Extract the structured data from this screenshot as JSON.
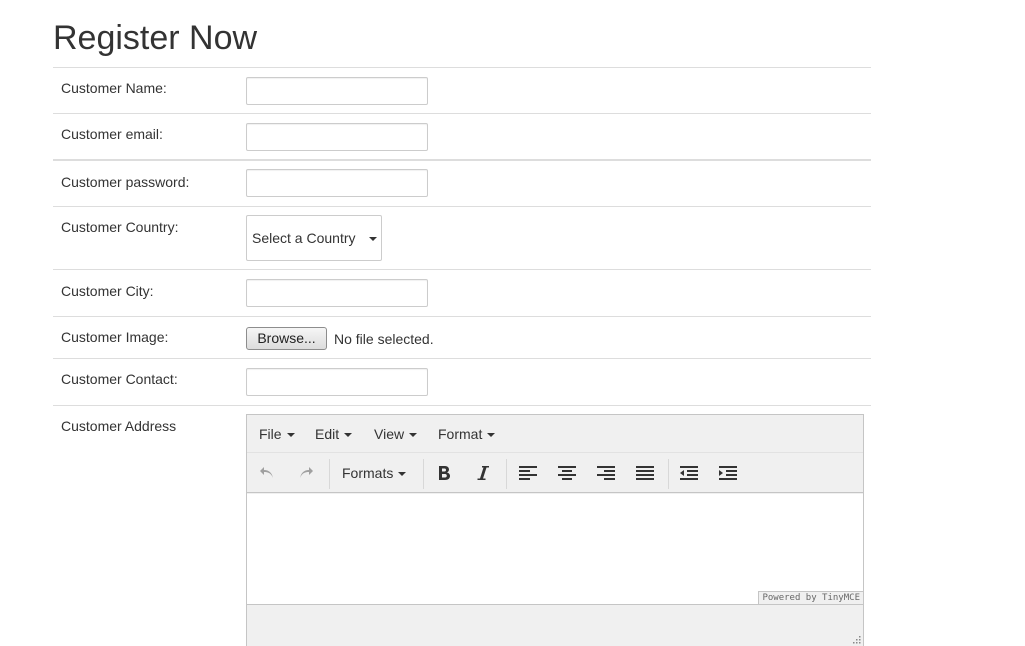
{
  "page": {
    "title": "Register Now"
  },
  "fields": {
    "name_label": "Customer Name:",
    "email_label": "Customer email:",
    "password_label": "Customer password:",
    "country_label": "Customer Country:",
    "country_selected": "Select a Country",
    "city_label": "Customer City:",
    "image_label": "Customer Image:",
    "browse_label": "Browse...",
    "file_status": "No file selected.",
    "contact_label": "Customer Contact:",
    "address_label": "Customer Address"
  },
  "editor": {
    "menu": {
      "file": "File",
      "edit": "Edit",
      "view": "View",
      "format": "Format"
    },
    "formats_label": "Formats",
    "powered_by": "Powered by TinyMCE",
    "icons": [
      "undo-icon",
      "redo-icon",
      "bold-icon",
      "italic-icon",
      "align-left-icon",
      "align-center-icon",
      "align-right-icon",
      "align-justify-icon",
      "outdent-icon",
      "indent-icon"
    ]
  }
}
